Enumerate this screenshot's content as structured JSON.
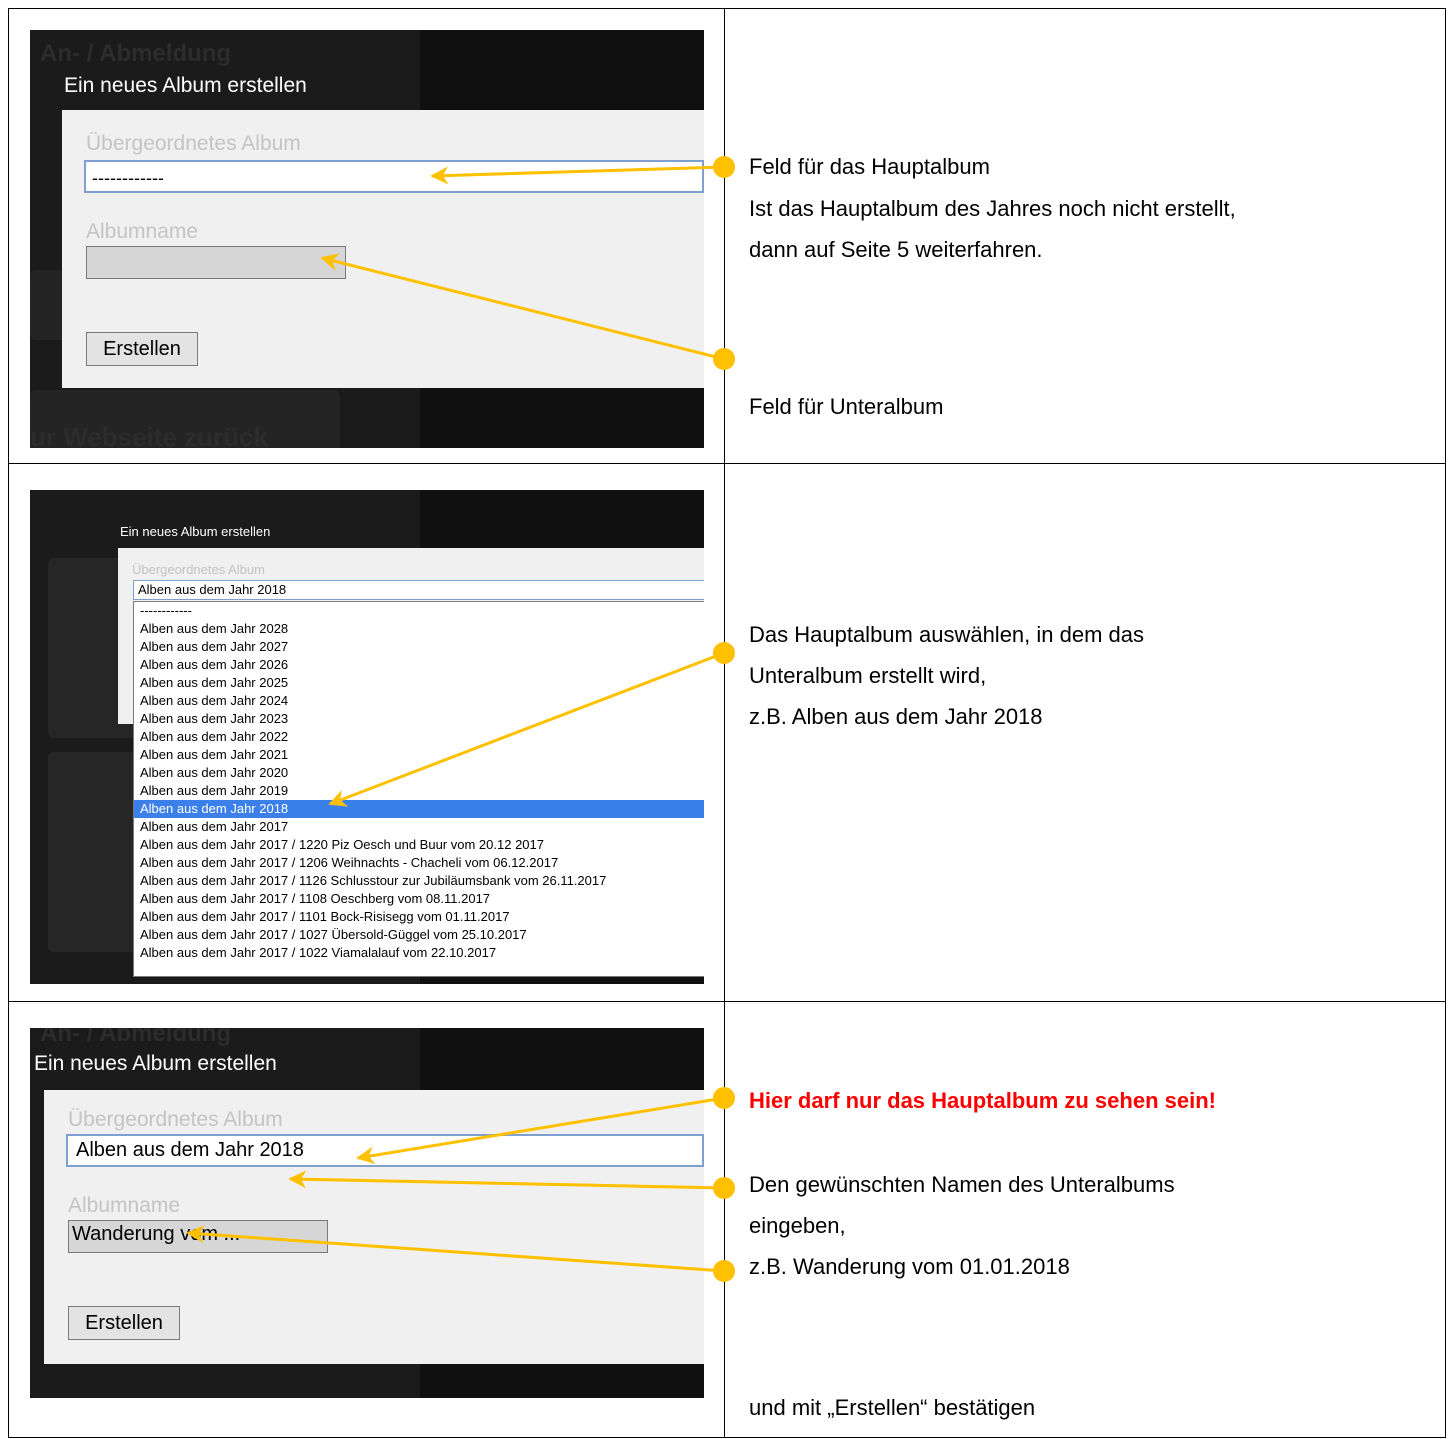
{
  "colors": {
    "arrow": "#ffc000",
    "highlight": "#3b80ea",
    "warning": "#ff0000"
  },
  "row1": {
    "bg_title": "An- / Abmeldung",
    "bg_title_bottom": "ur Webseite zurück",
    "dialog_title": "Ein neues Album erstellen",
    "parent_label": "Übergeordnetes Album",
    "parent_value": "------------",
    "name_label": "Albumname",
    "name_value": "",
    "button": "Erstellen",
    "note_1": "Feld für das Hauptalbum",
    "note_2": "Ist das Hauptalbum des Jahres noch nicht erstellt,",
    "note_3": "dann auf Seite 5 weiterfahren.",
    "note_4": "Feld für Unteralbum"
  },
  "row2": {
    "dialog_title": "Ein neues Album erstellen",
    "parent_label": "Übergeordnetes Album",
    "selected": "Alben aus dem Jahr 2018",
    "options": [
      "------------",
      "Alben aus dem Jahr 2028",
      "Alben aus dem Jahr 2027",
      "Alben aus dem Jahr 2026",
      "Alben aus dem Jahr 2025",
      "Alben aus dem Jahr 2024",
      "Alben aus dem Jahr 2023",
      "Alben aus dem Jahr 2022",
      "Alben aus dem Jahr 2021",
      "Alben aus dem Jahr 2020",
      "Alben aus dem Jahr 2019",
      "Alben aus dem Jahr 2018",
      "Alben aus dem Jahr 2017",
      "Alben aus dem Jahr 2017 / 1220 Piz Oesch und Buur vom 20.12 2017",
      "Alben aus dem Jahr 2017 / 1206 Weihnachts - Chacheli vom 06.12.2017",
      "Alben aus dem Jahr 2017 / 1126 Schlusstour zur Jubiläumsbank vom 26.11.2017",
      "Alben aus dem Jahr 2017 / 1108 Oeschberg vom 08.11.2017",
      "Alben aus dem Jahr 2017 / 1101 Bock-Risisegg vom 01.11.2017",
      "Alben aus dem Jahr 2017 / 1027 Übersold-Güggel vom 25.10.2017",
      "Alben aus dem Jahr 2017 / 1022 Viamalalauf vom 22.10.2017"
    ],
    "highlighted_option": "Alben aus dem Jahr 2018",
    "note_1": "Das Hauptalbum auswählen, in dem das",
    "note_2": "Unteralbum erstellt wird,",
    "note_3": "z.B. Alben aus dem Jahr 2018"
  },
  "row3": {
    "bg_title": "An- / Abmeldung",
    "dialog_title": "Ein neues Album erstellen",
    "parent_label": "Übergeordnetes Album",
    "parent_value": "Alben aus dem Jahr 2018",
    "name_label": "Albumname",
    "name_value": "Wanderung vom ...",
    "button": "Erstellen",
    "warning": "Hier darf nur das Hauptalbum zu sehen sein!",
    "note_1": "Den gewünschten Namen des Unteralbums",
    "note_2": "eingeben,",
    "note_3": "z.B. Wanderung vom 01.01.2018",
    "note_4": "und mit „Erstellen“ bestätigen"
  }
}
